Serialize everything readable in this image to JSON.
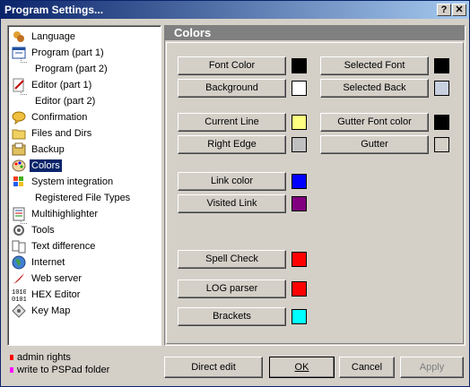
{
  "window": {
    "title": "Program Settings...",
    "help_button": "?",
    "close_button": "✕"
  },
  "tree": [
    {
      "label": "Language",
      "icon": "language-icon",
      "sub": false
    },
    {
      "label": "Program  (part 1)",
      "icon": "program-icon",
      "sub": false
    },
    {
      "label": "Program  (part 2)",
      "icon": "",
      "sub": true
    },
    {
      "label": "Editor  (part 1)",
      "icon": "editor-icon",
      "sub": false
    },
    {
      "label": "Editor  (part 2)",
      "icon": "",
      "sub": true
    },
    {
      "label": "Confirmation",
      "icon": "confirmation-icon",
      "sub": false
    },
    {
      "label": "Files and Dirs",
      "icon": "folder-icon",
      "sub": false
    },
    {
      "label": "Backup",
      "icon": "backup-icon",
      "sub": false
    },
    {
      "label": "Colors",
      "icon": "palette-icon",
      "sub": false,
      "selected": true
    },
    {
      "label": "System integration",
      "icon": "windows-icon",
      "sub": false
    },
    {
      "label": "Registered File Types",
      "icon": "",
      "sub": true
    },
    {
      "label": "Multihighlighter",
      "icon": "multihighlighter-icon",
      "sub": false
    },
    {
      "label": "Tools",
      "icon": "tools-icon",
      "sub": false
    },
    {
      "label": "Text difference",
      "icon": "text-difference-icon",
      "sub": false
    },
    {
      "label": "Internet",
      "icon": "globe-icon",
      "sub": false
    },
    {
      "label": "Web server",
      "icon": "web-server-icon",
      "sub": false
    },
    {
      "label": "HEX Editor",
      "icon": "hex-icon",
      "sub": false
    },
    {
      "label": "Key Map",
      "icon": "key-map-icon",
      "sub": false
    }
  ],
  "legend": {
    "admin": {
      "label": "admin rights",
      "color": "#ff0000"
    },
    "pspad": {
      "label": "write to PSPad folder",
      "color": "#ff00ff"
    }
  },
  "panel": {
    "title": "Colors",
    "items": [
      {
        "label": "Font Color",
        "color": "#000000"
      },
      {
        "label": "Background",
        "color": "#ffffff"
      },
      {
        "label": "Selected Font",
        "color": "#000000"
      },
      {
        "label": "Selected Back",
        "color": "#c8d0e0"
      },
      {
        "label": "Current Line",
        "color": "#ffff80"
      },
      {
        "label": "Right Edge",
        "color": "#c0c0c0"
      },
      {
        "label": "Gutter Font color",
        "color": "#000000"
      },
      {
        "label": "Gutter",
        "color": "#d4d0c8"
      },
      {
        "label": "Link color",
        "color": "#0000ff"
      },
      {
        "label": "Visited Link",
        "color": "#800080"
      },
      {
        "label": "Spell Check",
        "color": "#ff0000"
      },
      {
        "label": "LOG parser",
        "color": "#ff0000"
      },
      {
        "label": "Brackets",
        "color": "#00ffff"
      }
    ]
  },
  "footer": {
    "direct_edit": "Direct edit",
    "ok": "OK",
    "cancel": "Cancel",
    "apply": "Apply"
  }
}
